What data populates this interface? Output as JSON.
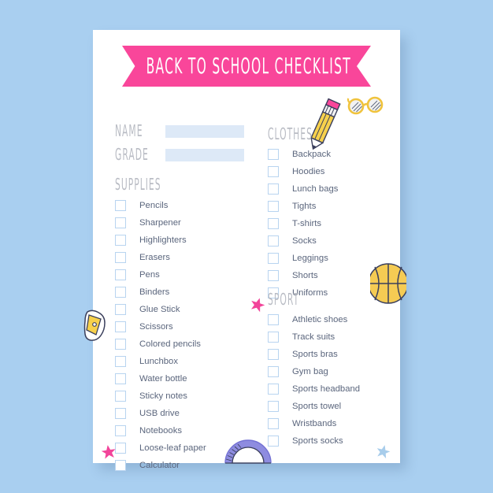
{
  "page": {
    "background_color": "#a9cff0",
    "card_color": "#ffffff"
  },
  "banner": {
    "title": "BACK TO SCHOOL CHECKLIST",
    "color": "#f9469a"
  },
  "form": {
    "name_label": "NAME",
    "grade_label": "GRADE",
    "name_value": "",
    "grade_value": "",
    "field_color": "#dde9f7"
  },
  "sections": {
    "supplies": {
      "heading": "SUPPLIES",
      "items": [
        "Pencils",
        "Sharpener",
        "Highlighters",
        "Erasers",
        "Pens",
        "Binders",
        "Glue Stick",
        "Scissors",
        "Colored pencils",
        "Lunchbox",
        "Water bottle",
        "Sticky notes",
        "USB drive",
        "Notebooks",
        "Loose-leaf paper",
        "Calculator"
      ]
    },
    "clothes": {
      "heading": "CLOTHES",
      "items": [
        "Backpack",
        "Hoodies",
        "Lunch bags",
        "Tights",
        "T-shirts",
        "Socks",
        "Leggings",
        "Shorts",
        "Uniforms"
      ]
    },
    "sport": {
      "heading": "SPORT",
      "items": [
        "Athletic shoes",
        "Track suits",
        "Sports bras",
        "Gym bag",
        "Sports headband",
        "Sports towel",
        "Wristbands",
        "Sports socks"
      ]
    }
  },
  "decorations": [
    {
      "name": "star-blue-top-left",
      "color": "#a8cdeb"
    },
    {
      "name": "pencil",
      "color": "#f7d14c"
    },
    {
      "name": "glasses",
      "color": "#f0c33c"
    },
    {
      "name": "star-pink-middle",
      "color": "#f2449a"
    },
    {
      "name": "basketball",
      "color": "#f5cb53"
    },
    {
      "name": "sharpener",
      "color": "#f7d14c"
    },
    {
      "name": "star-pink-bottom-left",
      "color": "#f2449a"
    },
    {
      "name": "protractor",
      "color": "#8e8ce0"
    },
    {
      "name": "star-blue-bottom-right",
      "color": "#a8cdeb"
    }
  ],
  "colors": {
    "accent_pink": "#f9469a",
    "checkbox_border": "#b8d4f0",
    "label_text": "#5b667d",
    "heading_text": "#b9bcc4"
  }
}
